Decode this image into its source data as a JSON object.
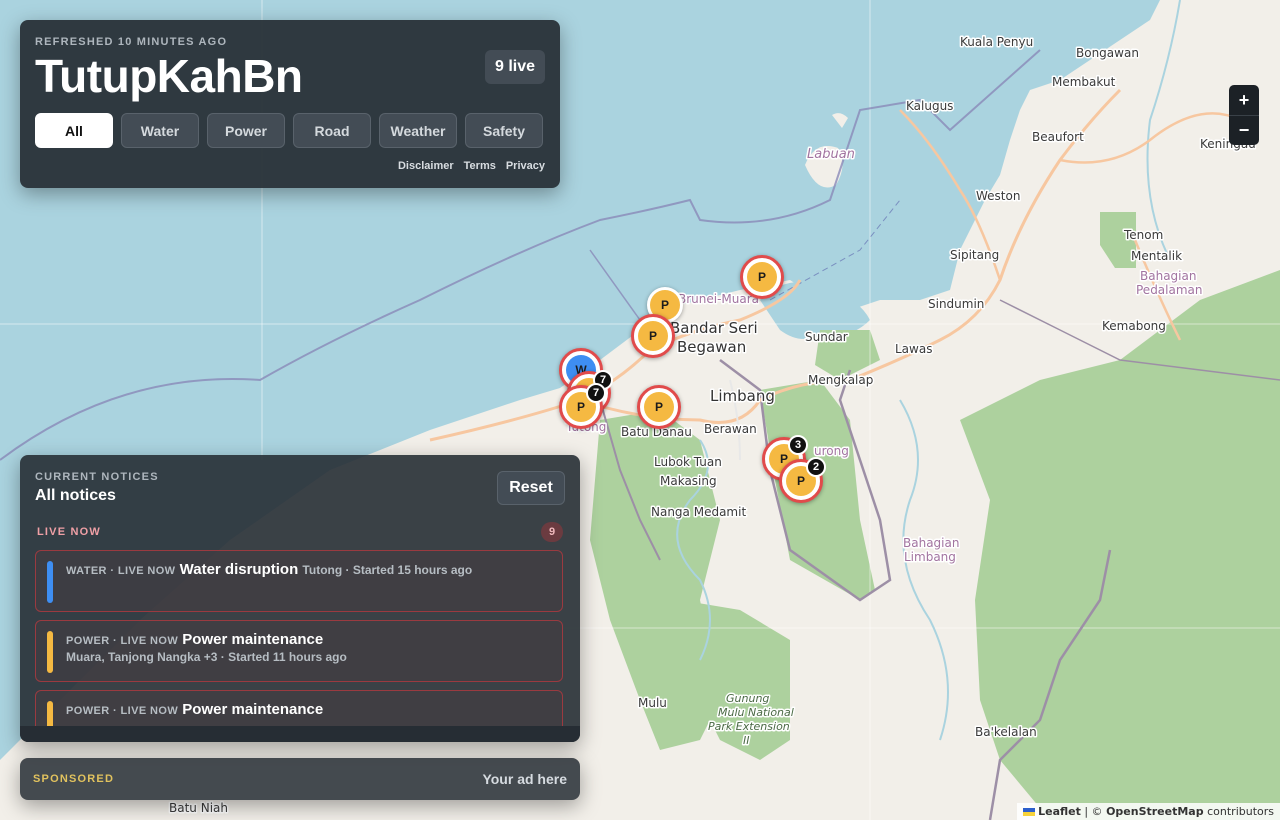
{
  "header": {
    "refreshed": "REFRESHED 10 MINUTES AGO",
    "title": "TutupKahBn",
    "live_badge": "9 live",
    "filters": [
      "All",
      "Water",
      "Power",
      "Road",
      "Weather",
      "Safety"
    ],
    "active_filter": "All",
    "links": [
      "Disclaimer",
      "Terms",
      "Privacy"
    ]
  },
  "notices": {
    "kicker": "CURRENT NOTICES",
    "title": "All notices",
    "reset_label": "Reset",
    "live_label": "LIVE NOW",
    "live_count": "9",
    "items": [
      {
        "category": "WATER · LIVE NOW",
        "title": "Water disruption",
        "meta": "Tutong · Started 15 hours ago",
        "type": "water"
      },
      {
        "category": "POWER · LIVE NOW",
        "title": "Power maintenance",
        "meta": "Muara, Tanjong Nangka +3 · Started 11 hours ago",
        "type": "power"
      },
      {
        "category": "POWER · LIVE NOW",
        "title": "Power maintenance",
        "meta": "",
        "type": "power"
      }
    ]
  },
  "sponsored": {
    "label": "SPONSORED",
    "ad": "Your ad here"
  },
  "zoom": {
    "in": "+",
    "out": "−"
  },
  "attribution": {
    "leaflet": "Leaflet",
    "separator": " | © ",
    "osm": "OpenStreetMap",
    "suffix": " contributors"
  },
  "markers": [
    {
      "type": "power",
      "letter": "P"
    },
    {
      "type": "power",
      "letter": "P"
    },
    {
      "type": "power",
      "letter": "P"
    },
    {
      "type": "water",
      "letter": "W"
    },
    {
      "type": "power",
      "letter": "P"
    },
    {
      "type": "power",
      "letter": "P"
    },
    {
      "type": "power",
      "letter": "P"
    },
    {
      "type": "power",
      "letter": "P"
    }
  ],
  "cluster_counts": [
    "7",
    "7",
    "3",
    "2"
  ],
  "map_labels": {
    "kuala_penyu": "Kuala Penyu",
    "bongawan": "Bongawan",
    "membakut": "Membakut",
    "kalugus": "Kalugus",
    "beaufort": "Beaufort",
    "keningau": "Keningau",
    "labuan": "Labuan",
    "weston": "Weston",
    "tenom": "Tenom",
    "mentalik": "Mentalik",
    "sipitang": "Sipitang",
    "bahagian_pedalaman_1": "Bahagian",
    "bahagian_pedalaman_2": "Pedalaman",
    "sindumin": "Sindumin",
    "kemabong": "Kemabong",
    "brunei_muara": "Brunei-Muara",
    "bandar_seri": "Bandar Seri",
    "begawan": "Begawan",
    "sundar": "Sundar",
    "lawas": "Lawas",
    "mengkalap": "Mengkalap",
    "limbang": "Limbang",
    "tutong": "Tutong",
    "batu_danau": "Batu Danau",
    "berawan": "Berawan",
    "temburong": "urong",
    "lubok_tuan": "Lubok Tuan",
    "makasing": "Makasing",
    "nanga_medamit": "Nanga Medamit",
    "bahagian_limbang_1": "Bahagian",
    "bahagian_limbang_2": "Limbang",
    "mulu": "Mulu",
    "gunung_1": "Gunung",
    "gunung_2": "Mulu National",
    "gunung_3": "Park Extension",
    "gunung_4": "II",
    "bakelalan": "Ba'kelalan",
    "batu_niah": "Batu Niah"
  }
}
